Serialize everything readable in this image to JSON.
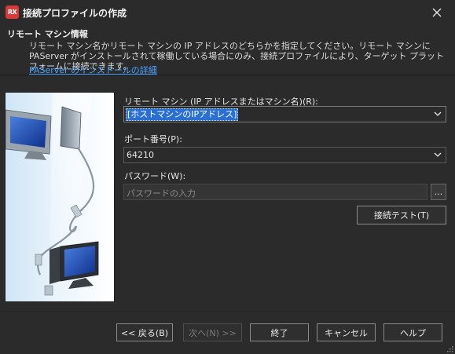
{
  "window": {
    "title": "接続プロファイルの作成",
    "app_icon_text": "RX"
  },
  "header": {
    "title": "リモート マシン情報",
    "description": "リモート マシン名かリモート マシンの IP アドレスのどちらかを指定してください。リモート マシンに PAServer がインストールされて稼働している場合にのみ、接続プロファイルにより、ターゲット プラットフォームに接続できます。",
    "link": "PAServer のインストールの詳細"
  },
  "form": {
    "remote_machine_label": "リモート マシン (IP アドレスまたはマシン名)(R):",
    "remote_machine_value": "[ホストマシンのIPアドレス]",
    "port_label": "ポート番号(P):",
    "port_value": "64210",
    "password_label": "パスワード(W):",
    "password_placeholder": "パスワードの入力",
    "password_browse_label": "...",
    "test_connection_label": "接続テスト(T)"
  },
  "buttons": {
    "back": "<< 戻る(B)",
    "next": "次へ(N) >>",
    "finish": "終了",
    "cancel": "キャンセル",
    "help": "ヘルプ"
  },
  "icons": {
    "close": "close-icon",
    "chevron": "chevron-down-icon",
    "illustration": "network-computers-illustration"
  },
  "colors": {
    "background": "#2b2b2b",
    "link": "#4aa3ff",
    "selection": "#2a6fd6",
    "app_icon": "#d63a3a"
  }
}
